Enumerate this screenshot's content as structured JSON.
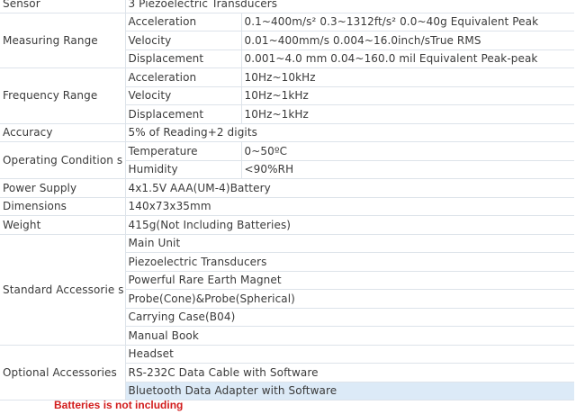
{
  "spec_table": {
    "sensor": {
      "label": "Sensor",
      "value": "3 Piezoelectric Transducers"
    },
    "measuring_range": {
      "label": "Measuring Range",
      "rows": [
        {
          "name": "Acceleration",
          "value": "0.1~400m/s² 0.3~1312ft/s² 0.0~40g Equivalent Peak"
        },
        {
          "name": "Velocity",
          "value": "0.01~400mm/s 0.004~16.0inch/sTrue RMS"
        },
        {
          "name": "Displacement",
          "value": "0.001~4.0 mm 0.04~160.0 mil Equivalent Peak-peak"
        }
      ]
    },
    "frequency_range": {
      "label": "Frequency Range",
      "rows": [
        {
          "name": "Acceleration",
          "value": "10Hz~10kHz"
        },
        {
          "name": "Velocity",
          "value": "10Hz~1kHz"
        },
        {
          "name": "Displacement",
          "value": "10Hz~1kHz"
        }
      ]
    },
    "accuracy": {
      "label": "Accuracy",
      "value": "5% of Reading+2 digits"
    },
    "operating_condition": {
      "label": "Operating Condition s",
      "rows": [
        {
          "name": "Temperature",
          "value": "0~50ºC"
        },
        {
          "name": "Humidity",
          "value": "<90%RH"
        }
      ]
    },
    "power_supply": {
      "label": "Power Supply",
      "value": "4x1.5V AAA(UM-4)Battery"
    },
    "dimensions": {
      "label": "Dimensions",
      "value": "140x73x35mm"
    },
    "weight": {
      "label": "Weight",
      "value": "415g(Not Including Batteries)"
    },
    "standard_accessories": {
      "label": "Standard Accessorie s",
      "items": [
        "Main Unit",
        "Piezoelectric Transducers",
        "Powerful Rare Earth Magnet",
        "Probe(Cone)&Probe(Spherical)",
        "Carrying Case(B04)",
        "Manual Book"
      ]
    },
    "optional_accessories": {
      "label": "Optional Accessories",
      "items": [
        "Headset",
        "RS-232C Data Cable with Software",
        "Bluetooth Data Adapter with Software"
      ]
    }
  },
  "footnote": "Batteries is not including",
  "colors": {
    "text": "#3a3a3a",
    "border": "#dde3ea",
    "highlight": "#dceaf7",
    "note": "#d21c1c"
  }
}
